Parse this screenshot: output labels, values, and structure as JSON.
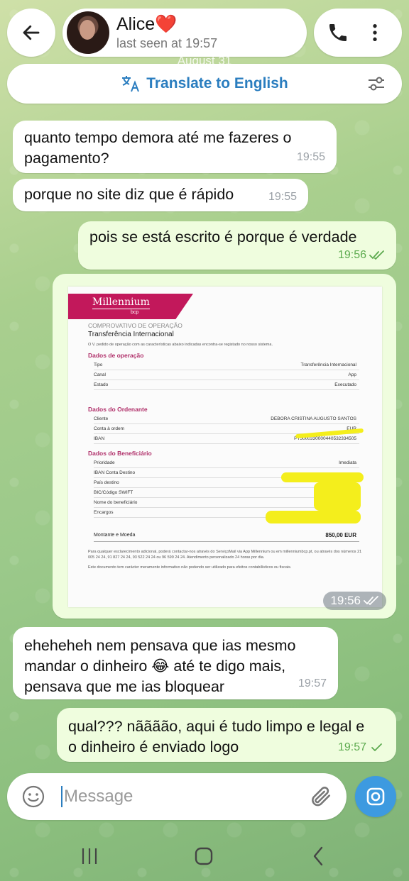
{
  "header": {
    "contact_name": "Alice❤️",
    "status": "last seen at 19:57"
  },
  "date_chip": "August 31",
  "translate": {
    "label": "Translate to English"
  },
  "messages": [
    {
      "direction": "in",
      "text": "quanto tempo demora até me fazeres o pagamento?",
      "time": "19:55"
    },
    {
      "direction": "in",
      "text": "porque no site diz que é rápido",
      "time": "19:55"
    },
    {
      "direction": "out",
      "text": "pois se está escrito é porque é verdade",
      "time": "19:56",
      "read": true
    },
    {
      "direction": "out",
      "type": "photo",
      "time": "19:56",
      "read": true
    },
    {
      "direction": "in",
      "text_line1": "eheheheh nem pensava que ias mesmo",
      "text_line2a": "mandar o dinheiro ",
      "emoji": "😂",
      "text_line2b": " até te digo mais,",
      "text_line3": "pensava que me ias bloquear",
      "time": "19:57"
    },
    {
      "direction": "out",
      "text": "qual??? nãããão, aqui é tudo limpo e legal e o dinheiro é enviado logo",
      "time": "19:57",
      "read": false
    }
  ],
  "document": {
    "brand": "Millennium",
    "brand_sub": "bcp",
    "title1": "COMPROVATIVO DE OPERAÇÃO",
    "title2": "Transferência Internacional",
    "intro": "O V. pedido de operação com as características abaixo indicadas encontra-se registado no nosso sistema.",
    "sections": {
      "operacao": "Dados de operação",
      "ordenante": "Dados do Ordenante",
      "beneficiario": "Dados do Beneficiário"
    },
    "operacao_rows": [
      {
        "k": "Tipo",
        "v": "Transferência Internacional"
      },
      {
        "k": "Canal",
        "v": "App"
      },
      {
        "k": "Estado",
        "v": "Executado"
      }
    ],
    "ordenante_rows": [
      {
        "k": "Cliente",
        "v": "DEBORA CRISTINA AUGUSTO SANTOS"
      },
      {
        "k": "Conta à ordem",
        "v": "EUR"
      },
      {
        "k": "IBAN",
        "v": "PT5000330000440532334505"
      }
    ],
    "beneficiario_rows": [
      {
        "k": "Prioridade",
        "v": "Imediata"
      },
      {
        "k": "IBAN Conta Destino",
        "v": ""
      },
      {
        "k": "País destino",
        "v": ""
      },
      {
        "k": "BIC/Código SWIFT",
        "v": ""
      },
      {
        "k": "Nome do beneficiário",
        "v": ""
      },
      {
        "k": "Encargos",
        "v": ""
      }
    ],
    "total_label": "Montante e Moeda",
    "total_value": "850,00 EUR",
    "footer1": "Para qualquer esclarecimento adicional, poderá contactar-nos através do ServiçoMail via App Millennium ou em millenniumbcp.pt, ou através dos números 21 005 24 24, 91 827 24 24, 93 522 24 24 ou 96 599 24 24. Atendimento personalizado 24 horas por dia.",
    "footer2": "Este documento tem carácter meramente informativo não podendo ser utilizado para efeitos contabilísticos ou fiscais."
  },
  "composer": {
    "placeholder": "Message"
  },
  "colors": {
    "outgoing": "#effdde",
    "incoming": "#ffffff",
    "accent": "#2a7dbf",
    "check": "#5caa4e"
  }
}
